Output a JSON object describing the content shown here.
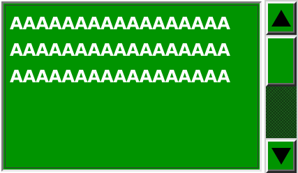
{
  "textarea": {
    "lines": [
      "AAAAAAAAAAAAAAAAA",
      "AAAAAAAAAAAAAAAAA",
      "AAAAAAAAAAAAAAAAA"
    ]
  },
  "scrollbar": {
    "up_icon": "arrow-up-icon",
    "down_icon": "arrow-down-icon"
  },
  "colors": {
    "background": "#009400",
    "text": "#ffffff",
    "arrow": "#000000"
  }
}
